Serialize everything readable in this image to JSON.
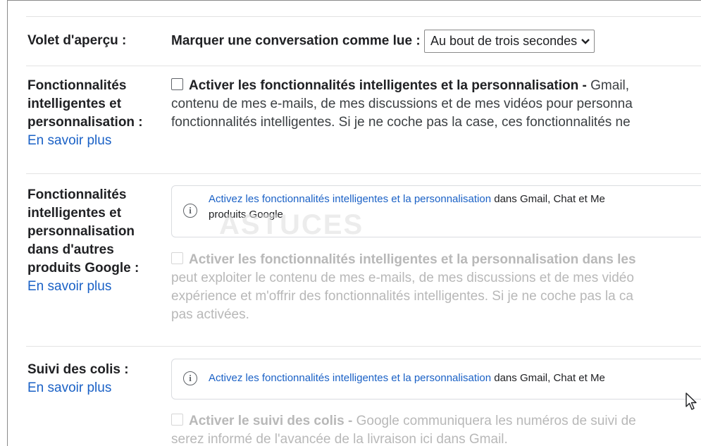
{
  "preview_pane": {
    "label": "Volet d'aperçu :",
    "mark_read_label": "Marquer une conversation comme lue :",
    "mark_read_value": "Au bout de trois secondes"
  },
  "smart_features": {
    "label_line1": "Fonctionnalités",
    "label_line2": "intelligentes et",
    "label_line3": "personnalisation :",
    "learn_more": "En savoir plus",
    "checkbox_title": "Activer les fonctionnalités intelligentes et la personnalisation -",
    "desc_line1_tail": "Gmail,",
    "desc_line2": "contenu de mes e-mails, de mes discussions et de mes vidéos pour personna",
    "desc_line3": "fonctionnalités intelligentes. Si je ne coche pas la case, ces fonctionnalités ne"
  },
  "smart_other_products": {
    "label_line1": "Fonctionnalités",
    "label_line2": "intelligentes et",
    "label_line3": "personnalisation",
    "label_line4": "dans d'autres",
    "label_line5": "produits Google :",
    "learn_more": "En savoir plus",
    "info_link": "Activez les fonctionnalités intelligentes et la personnalisation",
    "info_text_tail": " dans Gmail, Chat et Me",
    "info_line2": "produits Google",
    "checkbox_title": "Activer les fonctionnalités intelligentes et la personnalisation dans les",
    "desc_line2": "peut exploiter le contenu de mes e-mails, de mes discussions et de mes vidéo",
    "desc_line3": "expérience et m'offrir des fonctionnalités intelligentes. Si je ne coche pas la ca",
    "desc_line4": "pas activées.",
    "watermark": "ASTUCES"
  },
  "package_tracking": {
    "label": "Suivi des colis :",
    "learn_more": "En savoir plus",
    "info_link": "Activez les fonctionnalités intelligentes et la personnalisation",
    "info_text_tail": " dans Gmail, Chat et Me",
    "checkbox_title": "Activer le suivi des colis -",
    "desc_line1_tail": " Google communiquera les numéros de suivi de",
    "desc_line2": "serez informé de l'avancée de la livraison ici dans Gmail."
  }
}
